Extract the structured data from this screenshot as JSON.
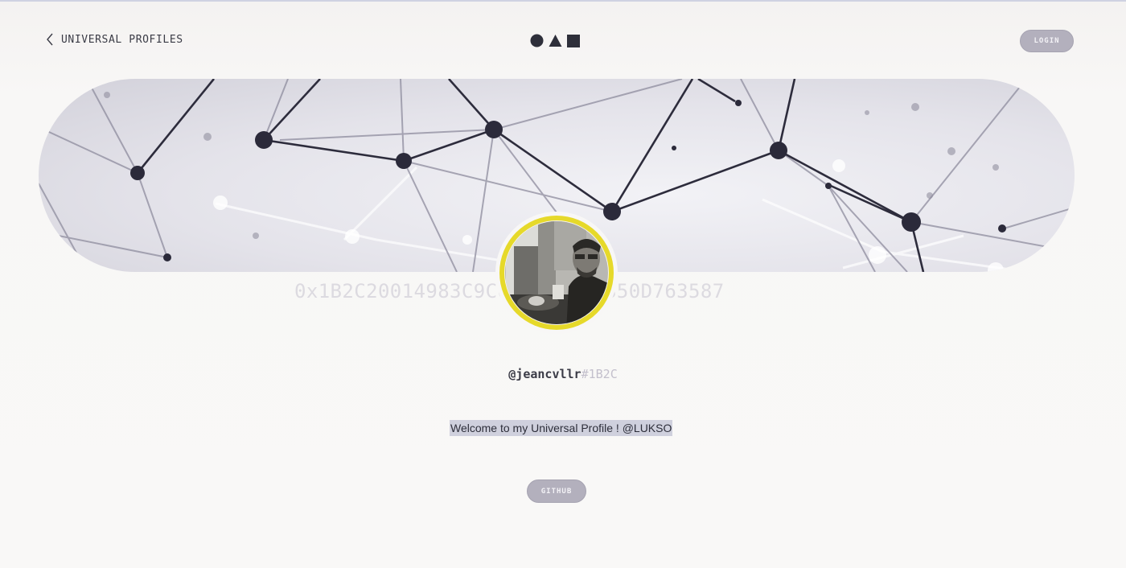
{
  "nav": {
    "back_label": "UNIVERSAL PROFILES",
    "back_icon": "chevron-left-icon",
    "logo_icons": [
      "circle-icon",
      "triangle-icon",
      "square-icon"
    ],
    "login_label": "LOGIN"
  },
  "profile": {
    "address": "0x1B2C20014983C9C0…A13603B350D763587",
    "handle": "@jeancvllr",
    "tag": "#1B2C",
    "bio": "Welcome to my Universal Profile ! @LUKSO",
    "avatar_ring_color": "#e6d92a"
  },
  "links": [
    {
      "label": "GITHUB"
    }
  ],
  "colors": {
    "button_bg": "#b3b0bd",
    "network_nodes": "#2b2a3a"
  }
}
